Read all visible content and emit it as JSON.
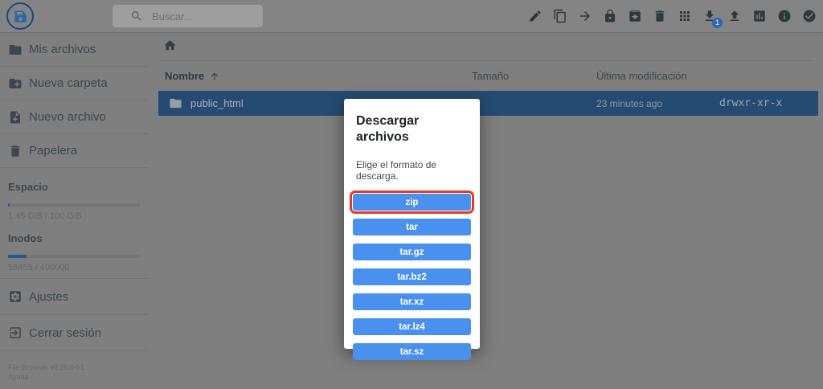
{
  "topbar": {
    "search": {
      "placeholder": "Buscar..."
    },
    "actions": [
      "edit",
      "copy",
      "move",
      "lock",
      "archive",
      "delete",
      "switch-view",
      "download",
      "upload",
      "usage-report",
      "info",
      "select"
    ],
    "download_badge": "1"
  },
  "sidebar": {
    "items": [
      {
        "label": "Mis archivos"
      },
      {
        "label": "Nueva carpeta"
      },
      {
        "label": "Nuevo archivo"
      },
      {
        "label": "Papelera"
      }
    ],
    "usage": {
      "space_label": "Espacio",
      "space_value": "1.45 GiB / 100 GiB",
      "space_percent": 1.5,
      "inodes_label": "Inodos",
      "inodes_value": "56455 / 400000",
      "inodes_percent": 14.1
    },
    "footer_items": [
      {
        "label": "Ajustes"
      },
      {
        "label": "Cerrar sesión"
      }
    ],
    "version": "File Browser v2.26.0-h1",
    "help": "Ayuda"
  },
  "main": {
    "table": {
      "headers": {
        "name": "Nombre",
        "size": "Tamaño",
        "modified": "Última modificación"
      },
      "rows": [
        {
          "name": "public_html",
          "modified": "23 minutes ago",
          "permissions": "drwxr-xr-x"
        }
      ]
    }
  },
  "modal": {
    "title": "Descargar archivos",
    "subtitle": "Elige el formato de descarga.",
    "formats": [
      "zip",
      "tar",
      "tar.gz",
      "tar.bz2",
      "tar.xz",
      "tar.lz4",
      "tar.sz"
    ],
    "highlighted_format": "zip"
  },
  "colors": {
    "accent_blue": "#4a90ee",
    "highlight_red": "#e23b28",
    "selected_row_blue": "#254b73",
    "badge_blue": "#2a67b4"
  }
}
